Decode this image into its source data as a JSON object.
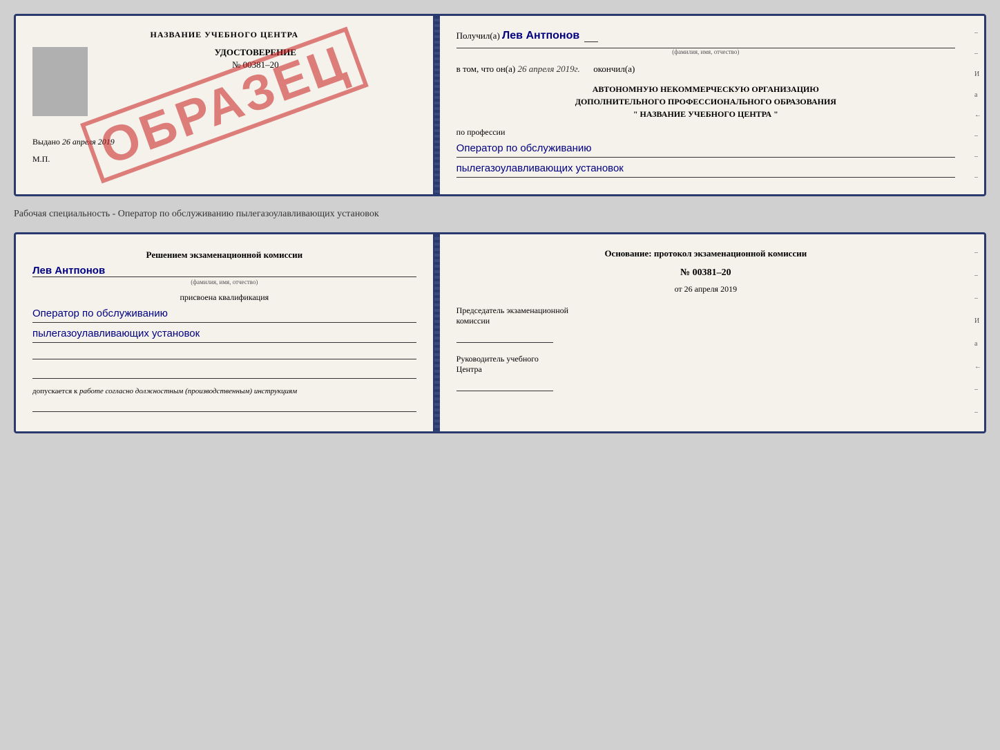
{
  "top_cert": {
    "left": {
      "training_center_title": "НАЗВАНИЕ УЧЕБНОГО ЦЕНТРА",
      "udostoverenie_label": "УДОСТОВЕРЕНИЕ",
      "cert_number": "№ 00381–20",
      "issued_label": "Выдано",
      "issued_date": "26 апреля 2019",
      "mp_label": "М.П.",
      "obrazec": "ОБРАЗЕЦ"
    },
    "right": {
      "received_label": "Получил(а)",
      "name": "Лев Антпонов",
      "fio_label": "(фамилия, имя, отчество)",
      "date_intro": "в том, что он(а)",
      "date_value": "26 апреля 2019г.",
      "finished_label": "окончил(а)",
      "org_line1": "АВТОНОМНУЮ НЕКОММЕРЧЕСКУЮ ОРГАНИЗАЦИЮ",
      "org_line2": "ДОПОЛНИТЕЛЬНОГО ПРОФЕССИОНАЛЬНОГО ОБРАЗОВАНИЯ",
      "org_line3": "\"   НАЗВАНИЕ УЧЕБНОГО ЦЕНТРА   \"",
      "profession_label": "по профессии",
      "profession_line1": "Оператор по обслуживанию",
      "profession_line2": "пылегазоулавливающих установок"
    }
  },
  "remark": "Рабочая специальность - Оператор по обслуживанию пылегазоулавливающих установок",
  "bottom_cert": {
    "left": {
      "komissia_line1": "Решением экзаменационной комиссии",
      "name": "Лев Антпонов",
      "fio_label": "(фамилия, имя, отчество)",
      "qualification_label": "присвоена квалификация",
      "qualification_line1": "Оператор по обслуживанию",
      "qualification_line2": "пылегазоулавливающих установок",
      "допускается_label": "допускается к",
      "допускается_text": "работе согласно должностным (производственным) инструкциям"
    },
    "right": {
      "osnov_label": "Основание: протокол экзаменационной комиссии",
      "protocol_num": "№  00381–20",
      "date_label": "от",
      "date_value": "26 апреля 2019",
      "predsed_line1": "Председатель экзаменационной",
      "predsed_line2": "комиссии",
      "ruk_line1": "Руководитель учебного",
      "ruk_line2": "Центра"
    }
  },
  "side_chars": {
    "top": [
      "И",
      "а",
      "←"
    ],
    "bottom": [
      "И",
      "а",
      "←"
    ]
  }
}
